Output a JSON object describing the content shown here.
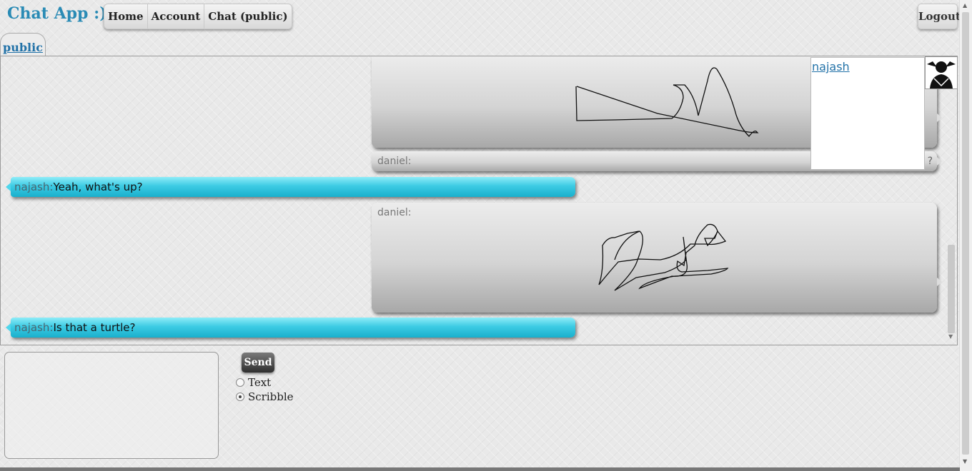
{
  "header": {
    "brand": "Chat App :)",
    "nav": [
      {
        "label": "Home"
      },
      {
        "label": "Account"
      },
      {
        "label": "Chat (public)"
      }
    ],
    "logout_label": "Logout"
  },
  "tabs": [
    {
      "label": "public",
      "active": true
    }
  ],
  "messages": [
    {
      "sender": "daniel",
      "kind": "scribble",
      "sender_label_visible": false
    },
    {
      "sender": "daniel",
      "kind": "text",
      "name_label": "daniel:",
      "trailing_text": "?"
    },
    {
      "sender": "najash",
      "kind": "text",
      "name_label": "najash:",
      "text": "Yeah, what's up?"
    },
    {
      "sender": "daniel",
      "kind": "scribble",
      "name_label": "daniel:"
    },
    {
      "sender": "najash",
      "kind": "text",
      "name_label": "najash:",
      "text": "Is that a turtle?"
    }
  ],
  "users_panel": {
    "users": [
      {
        "name": "najash"
      }
    ]
  },
  "composer": {
    "send_label": "Send",
    "modes": [
      {
        "label": "Text",
        "selected": false
      },
      {
        "label": "Scribble",
        "selected": true
      }
    ]
  },
  "colors": {
    "brand": "#2a8bb5",
    "link": "#2272a8",
    "own_message": "#3ccbe4",
    "other_message": "#d4d4d4"
  }
}
